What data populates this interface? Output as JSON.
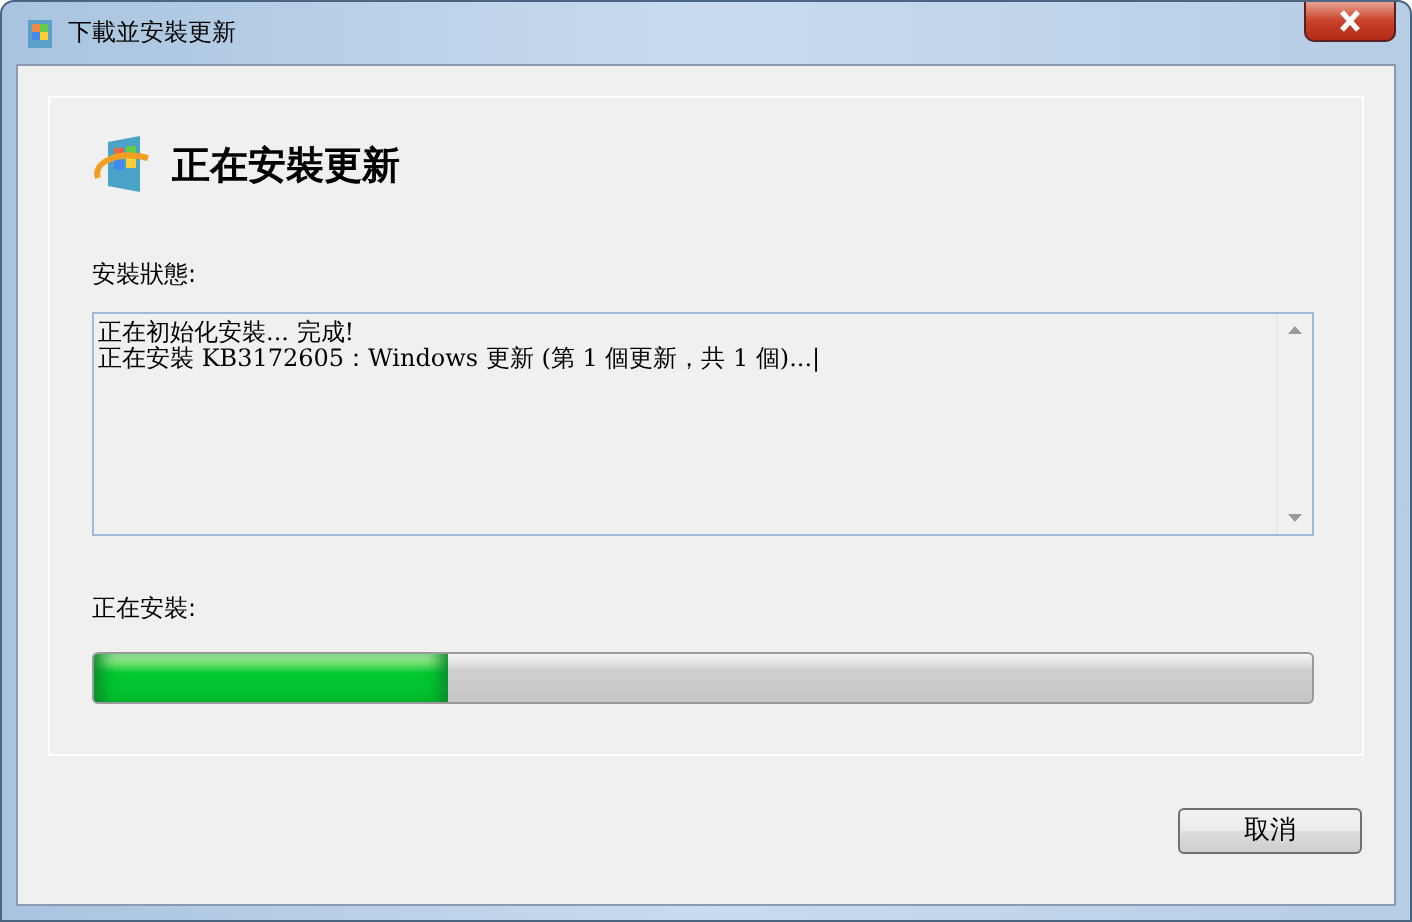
{
  "window": {
    "title": "下載並安裝更新"
  },
  "heading": "正在安裝更新",
  "status": {
    "label": "安裝狀態:",
    "lines": [
      "正在初始化安裝... 完成!",
      "正在安裝 KB3172605：Windows 更新 (第 1 個更新，共 1 個)...|"
    ]
  },
  "progress": {
    "label": "正在安裝:",
    "level": 0.29
  },
  "buttons": [
    "取消"
  ]
}
